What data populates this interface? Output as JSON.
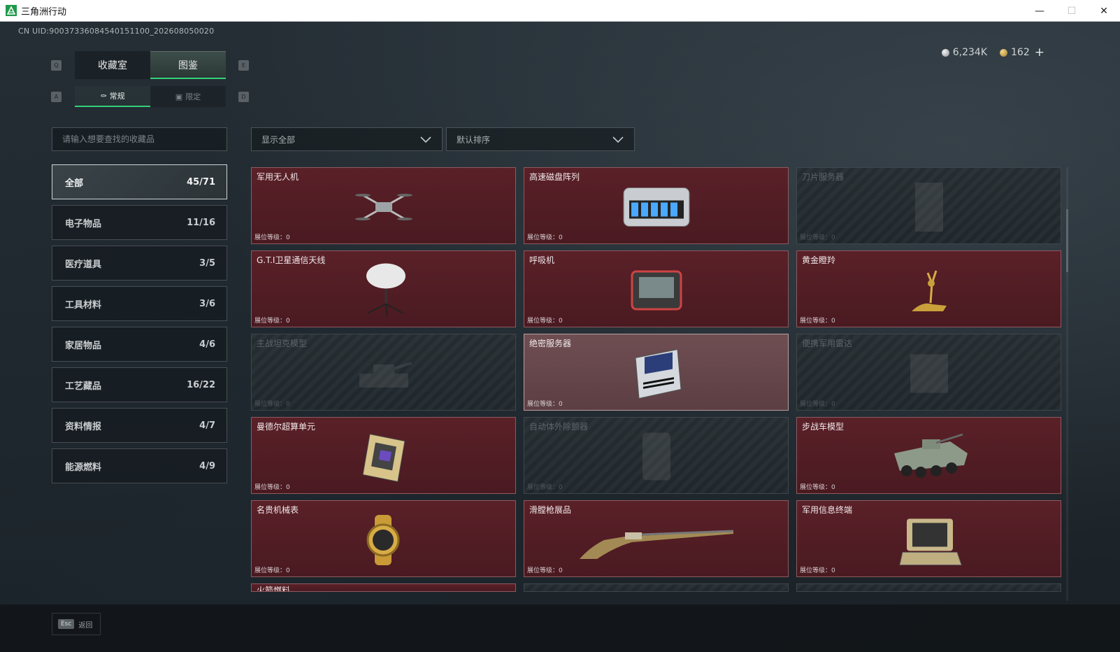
{
  "window": {
    "title": "三角洲行动",
    "minimize": "—",
    "maximize": "☐",
    "close": "✕"
  },
  "uid": "CN UID:9003733608454015110​0_202608050020",
  "currency": {
    "silver": "6,234K",
    "gold": "162",
    "plus": "+"
  },
  "tabs": {
    "left_key": "Q",
    "right_key": "E",
    "items": [
      {
        "label": "收藏室"
      },
      {
        "label": "图鉴"
      }
    ]
  },
  "subtabs": {
    "left_key": "A",
    "right_key": "D",
    "items": [
      {
        "label": "常规",
        "icon": "flask-icon"
      },
      {
        "label": "限定",
        "icon": "image-icon"
      }
    ]
  },
  "search": {
    "placeholder": "请输入想要查找的收藏品",
    "value": ""
  },
  "filters": {
    "display": "显示全部",
    "sort": "默认排序"
  },
  "categories": [
    {
      "label": "全部",
      "count": "45/71"
    },
    {
      "label": "电子物品",
      "count": "11/16"
    },
    {
      "label": "医疗道具",
      "count": "3/5"
    },
    {
      "label": "工具材料",
      "count": "3/6"
    },
    {
      "label": "家居物品",
      "count": "4/6"
    },
    {
      "label": "工艺藏品",
      "count": "16/22"
    },
    {
      "label": "资料情报",
      "count": "4/7"
    },
    {
      "label": "能源燃料",
      "count": "4/9"
    }
  ],
  "items": [
    {
      "name": "军用无人机",
      "level": "展位等级：0",
      "state": "owned",
      "art": "drone"
    },
    {
      "name": "高速磁盘阵列",
      "level": "展位等级：0",
      "state": "owned",
      "art": "disk"
    },
    {
      "name": "刀片服务器",
      "level": "展位等级：0",
      "state": "locked",
      "art": "blade"
    },
    {
      "name": "G.T.I卫星通信天线",
      "level": "展位等级：0",
      "state": "owned",
      "art": "antenna"
    },
    {
      "name": "呼吸机",
      "level": "展位等级：0",
      "state": "owned",
      "art": "ventilator"
    },
    {
      "name": "黄金瞪羚",
      "level": "展位等级：0",
      "state": "owned",
      "art": "gazelle"
    },
    {
      "name": "主战坦克模型",
      "level": "展位等级：0",
      "state": "locked",
      "art": "tank"
    },
    {
      "name": "绝密服务器",
      "level": "展位等级：0",
      "state": "selected",
      "art": "server"
    },
    {
      "name": "便携军用雷达",
      "level": "展位等级：0",
      "state": "locked",
      "art": "radar"
    },
    {
      "name": "曼德尔超算单元",
      "level": "展位等级：0",
      "state": "owned",
      "art": "chip"
    },
    {
      "name": "自动体外除颤器",
      "level": "展位等级：0",
      "state": "locked",
      "art": "aed"
    },
    {
      "name": "步战车模型",
      "level": "展位等级：0",
      "state": "owned",
      "art": "ifv"
    },
    {
      "name": "名贵机械表",
      "level": "展位等级：0",
      "state": "owned",
      "art": "watch"
    },
    {
      "name": "滑膛枪展品",
      "level": "展位等级：0",
      "state": "owned",
      "art": "musket"
    },
    {
      "name": "军用信息终端",
      "level": "展位等级：0",
      "state": "owned",
      "art": "terminal"
    }
  ],
  "partial_row": [
    "火箭燃料",
    "",
    ""
  ],
  "bottom": {
    "esc_key": "Esc",
    "esc_label": "返回"
  },
  "colors": {
    "accent": "#33d17a",
    "owned_card": "#4f1c23",
    "locked_card": "#22292e"
  }
}
